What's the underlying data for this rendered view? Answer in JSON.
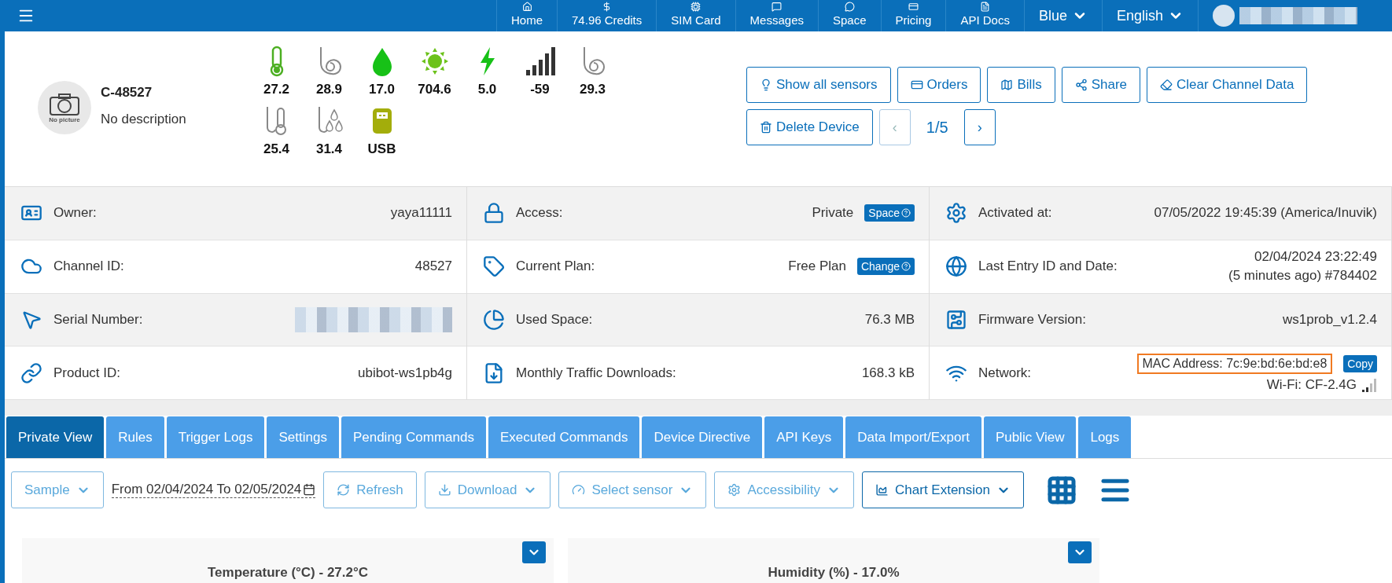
{
  "nav": {
    "items": [
      {
        "label": "Home"
      },
      {
        "label": "74.96 Credits"
      },
      {
        "label": "SIM Card"
      },
      {
        "label": "Messages"
      },
      {
        "label": "Space"
      },
      {
        "label": "Pricing"
      },
      {
        "label": "API Docs"
      }
    ],
    "menus": [
      {
        "label": "Blue"
      },
      {
        "label": "English"
      }
    ]
  },
  "device": {
    "name": "C-48527",
    "description": "No description",
    "avatar_label": "No picture",
    "sensors": [
      {
        "kind": "thermometer",
        "value": "27.2"
      },
      {
        "kind": "probe",
        "value": "28.9"
      },
      {
        "kind": "drop",
        "value": "17.0"
      },
      {
        "kind": "sun",
        "value": "704.6"
      },
      {
        "kind": "bolt",
        "value": "5.0"
      },
      {
        "kind": "signal",
        "value": "-59"
      },
      {
        "kind": "probe",
        "value": "29.3"
      },
      {
        "kind": "probe-thermometer",
        "value": "25.4"
      },
      {
        "kind": "probe-drops",
        "value": "31.4"
      },
      {
        "kind": "usb",
        "value": "USB"
      }
    ],
    "buttons": [
      {
        "label": "Show all sensors"
      },
      {
        "label": "Orders"
      },
      {
        "label": "Bills"
      },
      {
        "label": "Share"
      },
      {
        "label": "Clear Channel Data"
      },
      {
        "label": "Delete Device"
      }
    ],
    "pager": {
      "prev": "‹",
      "page": "1/5",
      "next": "›",
      "prev_disabled": true
    }
  },
  "info": [
    [
      {
        "kind": "text",
        "label": "Owner:",
        "value": "yaya11111"
      },
      {
        "kind": "text",
        "label": "Channel ID:",
        "value": "48527"
      },
      {
        "kind": "redacted",
        "label": "Serial Number:"
      },
      {
        "kind": "text",
        "label": "Product ID:",
        "value": "ubibot-ws1pb4g"
      }
    ],
    [
      {
        "kind": "badge",
        "label": "Access:",
        "value": "Private",
        "badge": "Space"
      },
      {
        "kind": "badge",
        "label": "Current Plan:",
        "value": "Free Plan",
        "badge": "Change"
      },
      {
        "kind": "text",
        "label": "Used Space:",
        "value": "76.3 MB"
      },
      {
        "kind": "text",
        "label": "Monthly Traffic Downloads:",
        "value": "168.3 kB"
      }
    ],
    [
      {
        "kind": "text",
        "label": "Activated at:",
        "value": "07/05/2022 19:45:39 (America/Inuvik)"
      },
      {
        "kind": "multiline",
        "label": "Last Entry ID and Date:",
        "lines": [
          "02/04/2024 23:22:49",
          "(5 minutes ago) #784402"
        ]
      },
      {
        "kind": "text",
        "label": "Firmware Version:",
        "value": "ws1prob_v1.2.4"
      },
      {
        "kind": "network",
        "label": "Network:",
        "mac": "MAC Address: 7c:9e:bd:6e:bd:e8",
        "highlighted": true,
        "copy": "Copy",
        "wifi": "Wi-Fi: CF-2.4G"
      }
    ]
  ],
  "tabs": [
    {
      "label": "Private View",
      "selected": true
    },
    {
      "label": "Rules",
      "selected": false
    },
    {
      "label": "Trigger Logs",
      "selected": false
    },
    {
      "label": "Settings",
      "selected": false
    },
    {
      "label": "Pending Commands",
      "selected": false
    },
    {
      "label": "Executed Commands",
      "selected": false
    },
    {
      "label": "Device Directive",
      "selected": false
    },
    {
      "label": "API Keys",
      "selected": false
    },
    {
      "label": "Data Import/Export",
      "selected": false
    },
    {
      "label": "Public View",
      "selected": false
    },
    {
      "label": "Logs",
      "selected": false
    }
  ],
  "toolbar": {
    "sample": "Sample",
    "date_range": "From 02/04/2024 To 02/05/2024",
    "buttons": [
      {
        "label": "Refresh",
        "kind": "refresh",
        "dropdown": false,
        "emphasized": false
      },
      {
        "label": "Download",
        "kind": "download",
        "dropdown": true,
        "emphasized": false
      },
      {
        "label": "Select sensor",
        "kind": "gauge",
        "dropdown": true,
        "emphasized": false
      },
      {
        "label": "Accessibility",
        "kind": "gear",
        "dropdown": true,
        "emphasized": false
      },
      {
        "label": "Chart Extension",
        "kind": "chart",
        "dropdown": true,
        "emphasized": true
      }
    ]
  },
  "charts": [
    {
      "title": "Temperature (°C) - 27.2°C"
    },
    {
      "title": "Humidity (%) - 17.0%"
    }
  ]
}
